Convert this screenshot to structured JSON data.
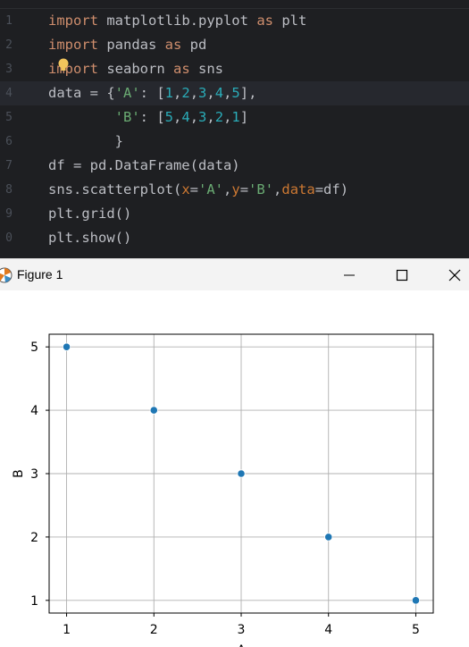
{
  "editor": {
    "lines": [
      {
        "num": "1",
        "tokens": [
          {
            "t": "import",
            "c": "kw"
          },
          {
            "t": " matplotlib.pyplot ",
            "c": ""
          },
          {
            "t": "as",
            "c": "kw"
          },
          {
            "t": " plt",
            "c": ""
          }
        ]
      },
      {
        "num": "2",
        "tokens": [
          {
            "t": "import",
            "c": "kw"
          },
          {
            "t": " pandas ",
            "c": ""
          },
          {
            "t": "as",
            "c": "kw"
          },
          {
            "t": " pd",
            "c": ""
          }
        ]
      },
      {
        "num": "3",
        "tokens": [
          {
            "t": "import",
            "c": "kw"
          },
          {
            "t": " seaborn ",
            "c": ""
          },
          {
            "t": "as",
            "c": "kw"
          },
          {
            "t": " sns",
            "c": ""
          }
        ]
      },
      {
        "num": "4",
        "tokens": [
          {
            "t": "data = {",
            "c": ""
          },
          {
            "t": "'A'",
            "c": "str"
          },
          {
            "t": ": [",
            "c": ""
          },
          {
            "t": "1",
            "c": "num"
          },
          {
            "t": ",",
            "c": ""
          },
          {
            "t": "2",
            "c": "num"
          },
          {
            "t": ",",
            "c": ""
          },
          {
            "t": "3",
            "c": "num"
          },
          {
            "t": ",",
            "c": ""
          },
          {
            "t": "4",
            "c": "num"
          },
          {
            "t": ",",
            "c": ""
          },
          {
            "t": "5",
            "c": "num"
          },
          {
            "t": "],",
            "c": ""
          }
        ]
      },
      {
        "num": "5",
        "tokens": [
          {
            "t": "        ",
            "c": ""
          },
          {
            "t": "'B'",
            "c": "str"
          },
          {
            "t": ": [",
            "c": ""
          },
          {
            "t": "5",
            "c": "num"
          },
          {
            "t": ",",
            "c": ""
          },
          {
            "t": "4",
            "c": "num"
          },
          {
            "t": ",",
            "c": ""
          },
          {
            "t": "3",
            "c": "num"
          },
          {
            "t": ",",
            "c": ""
          },
          {
            "t": "2",
            "c": "num"
          },
          {
            "t": ",",
            "c": ""
          },
          {
            "t": "1",
            "c": "num"
          },
          {
            "t": "]",
            "c": ""
          }
        ]
      },
      {
        "num": "6",
        "tokens": [
          {
            "t": "        }",
            "c": ""
          }
        ]
      },
      {
        "num": "7",
        "tokens": [
          {
            "t": "df = pd.DataFrame(data)",
            "c": ""
          }
        ]
      },
      {
        "num": "8",
        "tokens": [
          {
            "t": "sns.scatterplot(",
            "c": ""
          },
          {
            "t": "x",
            "c": "param"
          },
          {
            "t": "=",
            "c": ""
          },
          {
            "t": "'A'",
            "c": "str"
          },
          {
            "t": ",",
            "c": ""
          },
          {
            "t": "y",
            "c": "param"
          },
          {
            "t": "=",
            "c": ""
          },
          {
            "t": "'B'",
            "c": "str"
          },
          {
            "t": ",",
            "c": ""
          },
          {
            "t": "data",
            "c": "param"
          },
          {
            "t": "=df)",
            "c": ""
          }
        ]
      },
      {
        "num": "9",
        "tokens": [
          {
            "t": "plt.grid()",
            "c": ""
          }
        ]
      },
      {
        "num": "0",
        "tokens": [
          {
            "t": "plt.show()",
            "c": ""
          }
        ]
      }
    ],
    "current_line": 4
  },
  "window": {
    "title": "Figure 1",
    "minimize_icon": "minimize-icon",
    "maximize_icon": "maximize-icon",
    "close_icon": "close-icon"
  },
  "chart_data": {
    "type": "scatter",
    "x": [
      1,
      2,
      3,
      4,
      5
    ],
    "y": [
      5,
      4,
      3,
      2,
      1
    ],
    "xlabel": "A",
    "ylabel": "B",
    "xticks": [
      "1",
      "2",
      "3",
      "4",
      "5"
    ],
    "yticks": [
      "1",
      "2",
      "3",
      "4",
      "5"
    ],
    "xlim": [
      0.8,
      5.2
    ],
    "ylim": [
      0.8,
      5.2
    ],
    "grid": true,
    "marker_color": "#1f77b4"
  }
}
